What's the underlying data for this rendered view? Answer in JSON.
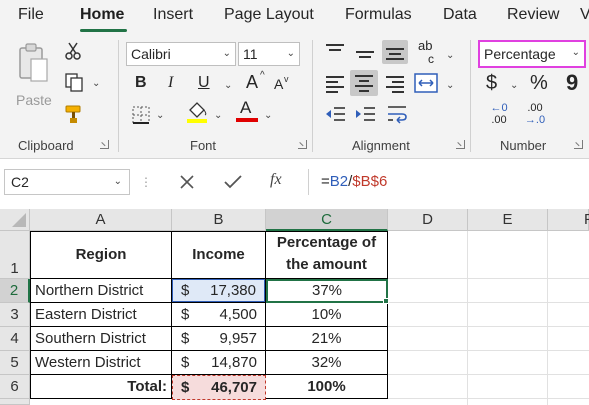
{
  "menu": {
    "file": "File",
    "home": "Home",
    "insert": "Insert",
    "page_layout": "Page Layout",
    "formulas": "Formulas",
    "data": "Data",
    "review": "Review",
    "overflow": "V"
  },
  "ribbon": {
    "clipboard": {
      "label": "Clipboard",
      "paste": "Paste"
    },
    "font": {
      "label": "Font",
      "name": "Calibri",
      "size": "11",
      "bold": "B",
      "italic": "I",
      "underline": "U",
      "grow": "A",
      "shrink": "A",
      "font_color_letter": "A"
    },
    "alignment": {
      "label": "Alignment",
      "orientation": "ab",
      "orientation_sub": "c"
    },
    "number": {
      "label": "Number",
      "format": "Percentage",
      "currency": "$",
      "percent": "%",
      "comma": "9",
      "inc_decimal_top": "←0",
      "inc_decimal_bottom": ".00",
      "dec_decimal_top": ".00",
      "dec_decimal_bottom": "→.0"
    }
  },
  "formula_bar": {
    "name_box": "C2",
    "formula_prefix": "=",
    "formula_ref1": "B2",
    "formula_slash": "/",
    "formula_ref2": "$B$6",
    "fx": "fx"
  },
  "columns": [
    "A",
    "B",
    "C",
    "D",
    "E",
    "F"
  ],
  "rows": [
    "1",
    "2",
    "3",
    "4",
    "5",
    "6"
  ],
  "table": {
    "header_region": "Region",
    "header_income": "Income",
    "header_percentage_line1": "Percentage of",
    "header_percentage_line2": "the amount",
    "data": [
      {
        "region": "Northern District",
        "currency": "$",
        "income": "17,380",
        "percentage": "37%"
      },
      {
        "region": "Eastern District",
        "currency": "$",
        "income": "4,500",
        "percentage": "10%"
      },
      {
        "region": "Southern District",
        "currency": "$",
        "income": "9,957",
        "percentage": "21%"
      },
      {
        "region": "Western District",
        "currency": "$",
        "income": "14,870",
        "percentage": "32%"
      }
    ],
    "total_label": "Total:",
    "total_currency": "$",
    "total_income": "46,707",
    "total_percentage": "100%"
  },
  "colors": {
    "excel_green": "#217346",
    "ref_blue": "#2f5eb9",
    "ref_red": "#c0392b",
    "highlight_magenta": "#e040e0",
    "fill_yellow": "#ffff00",
    "font_red": "#e00000"
  }
}
